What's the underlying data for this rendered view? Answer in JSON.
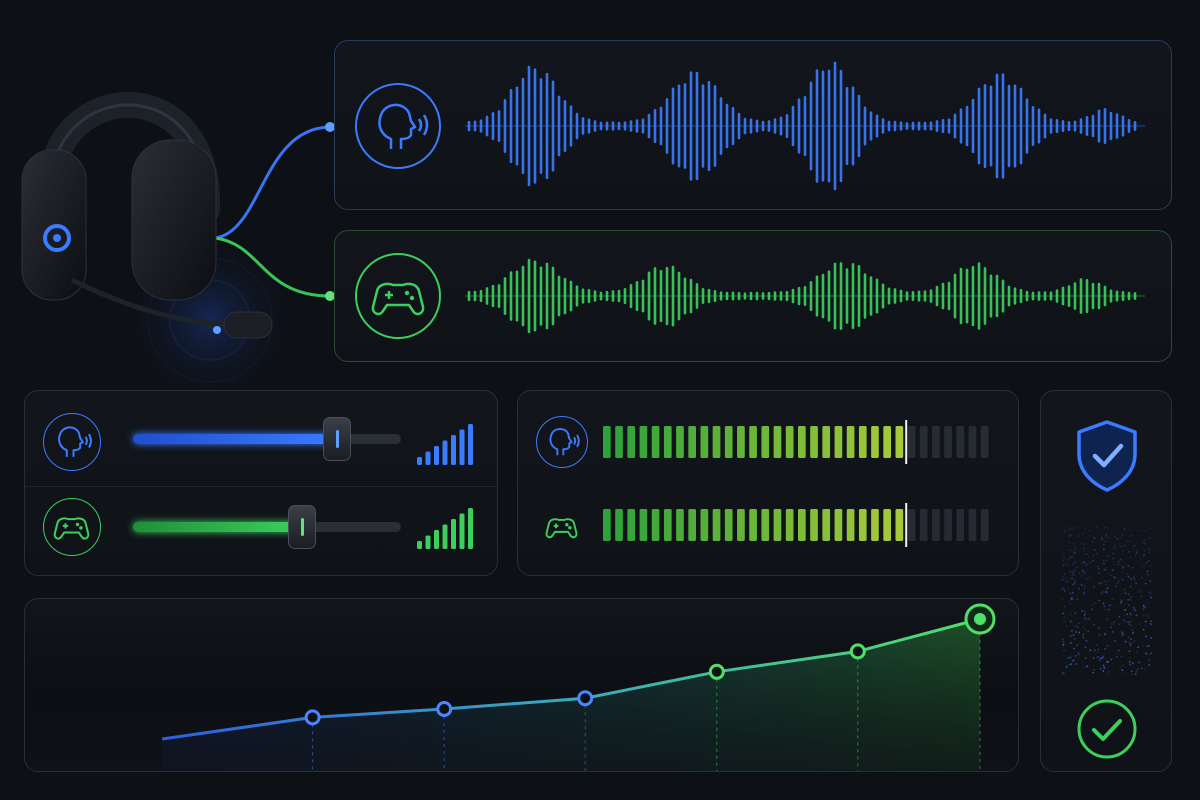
{
  "colors": {
    "background": "#0d1015",
    "voice_blue": "#3b7bff",
    "game_green": "#3ccf5e",
    "meter_yellow": "#d6e03a",
    "panel_border": "#2a2f37"
  },
  "streams": [
    {
      "name": "voice",
      "icon": "voice-icon",
      "color": "#3b7bff"
    },
    {
      "name": "game",
      "icon": "gamepad-icon",
      "color": "#3ccf5e"
    }
  ],
  "mixer": {
    "voice_volume": 0.76,
    "game_volume": 0.63,
    "voice_signal_bars": 7,
    "game_signal_bars": 7
  },
  "meters": {
    "segments": 32,
    "voice_level": 0.78,
    "game_level": 0.78,
    "peak_marker": 0.78
  },
  "trend": {
    "points": [
      0.13,
      0.29,
      0.43,
      0.58,
      0.72,
      0.87,
      1.0
    ],
    "values": [
      0.0,
      0.18,
      0.25,
      0.34,
      0.56,
      0.73,
      1.0
    ]
  },
  "status": {
    "protection_icon": "shield-check-icon",
    "confirm_icon": "check-circle-icon"
  }
}
